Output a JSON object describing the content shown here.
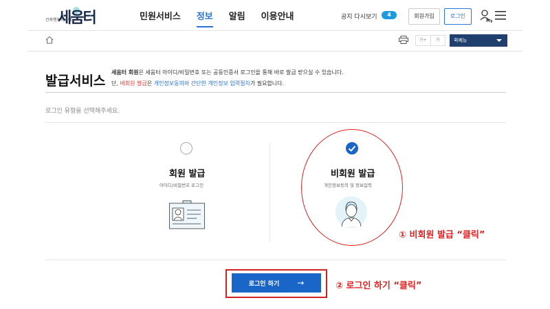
{
  "header": {
    "logo_sub": "건축행정시스템",
    "logo_main": "세움터",
    "nav": [
      {
        "label": "민원서비스",
        "active": false
      },
      {
        "label": "정보",
        "active": true
      },
      {
        "label": "알림",
        "active": false
      },
      {
        "label": "이용안내",
        "active": false
      }
    ],
    "notice_label": "공지 다시보기",
    "notice_count": "4",
    "join_label": "회원가입",
    "login_label": "로그인",
    "my_label": "My"
  },
  "subbar": {
    "font_small": "가+",
    "font_large": "가",
    "quick_menu": "퀵메뉴"
  },
  "page": {
    "title": "발급서비스",
    "desc1_bold": "세움터 회원",
    "desc1_rest": "은 세움터 아이디/비밀번호 또는 공동인증서 로그인을 통해 바로 발급 받으실 수 있습니다.",
    "desc2_prefix": "단, ",
    "desc2_red": "비회원 발급",
    "desc2_mid": "은 ",
    "desc2_blue": "개인정보동의와 간단한 개인정보 입력절차",
    "desc2_suffix": "가 필요합니다.",
    "guide": "로그인 유형을 선택해주세요."
  },
  "options": {
    "member": {
      "title": "회원 발급",
      "sub": "아이디/비밀번호 로그인",
      "selected": false
    },
    "nonmember": {
      "title": "비회원 발급",
      "sub": "개인정보동의 및 정보입력",
      "selected": true
    }
  },
  "login_button": {
    "label": "로그인 하기",
    "arrow": "→"
  },
  "annotations": {
    "step1": "① 비회원 발급 “클릭”",
    "step2": "② 로그인 하기 “클릭”"
  },
  "colors": {
    "accent_blue": "#2a73d9",
    "button_blue": "#1a65c8",
    "annotation_red": "#e02020",
    "quick_menu_bg": "#1f3f6e",
    "badge_blue": "#1e9be0"
  }
}
